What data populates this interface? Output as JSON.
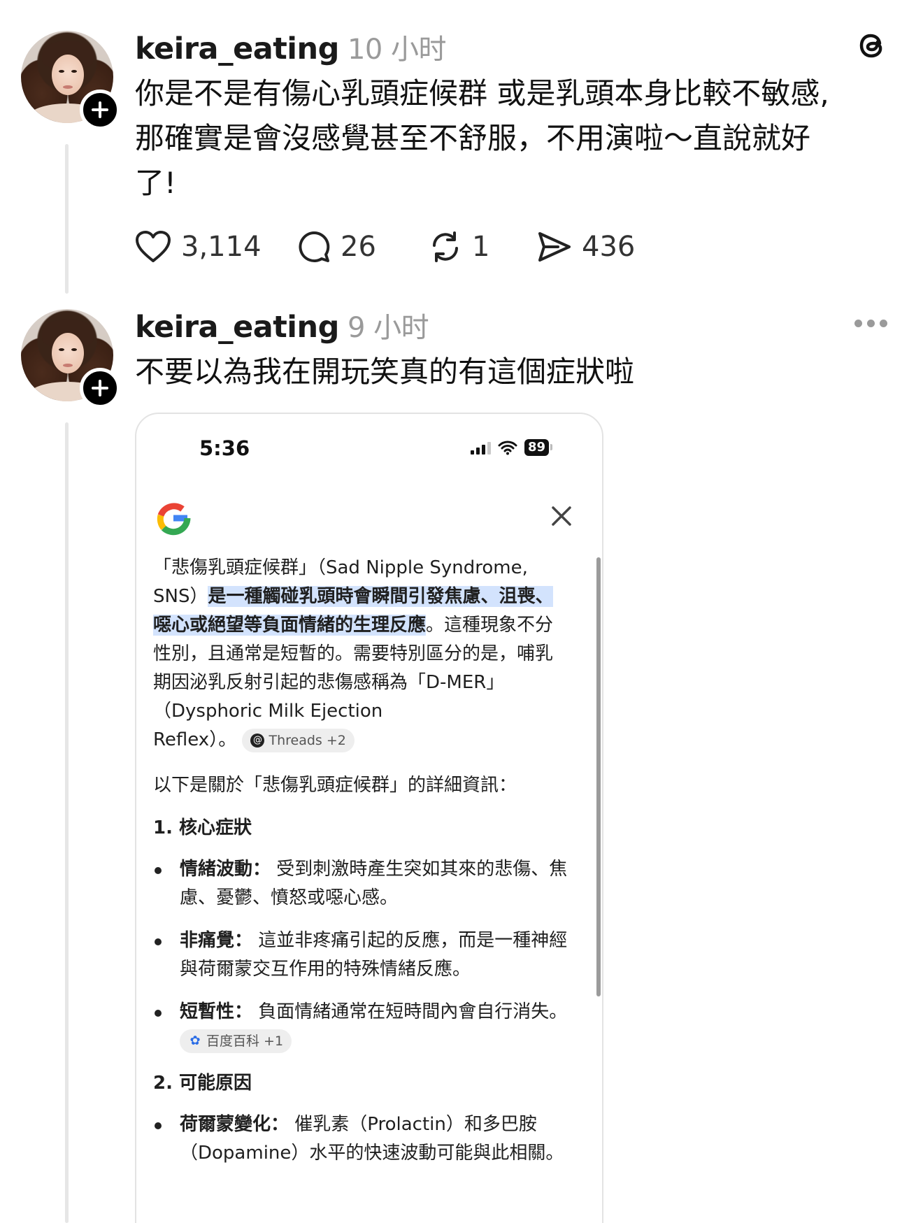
{
  "posts": [
    {
      "username": "keira_eating",
      "time": "10 小时",
      "text_lines": [
        "你是不是有傷心乳頭症候群 或是乳頭本身比較不敏感,",
        "那確實是會沒感覺甚至不舒服，不用演啦～直說就好",
        "了!"
      ],
      "likes": "3,114",
      "replies": "26",
      "reposts": "1",
      "shares": "436"
    },
    {
      "username": "keira_eating",
      "time": "9 小时",
      "text": "不要以為我在開玩笑真的有這個症狀啦"
    }
  ],
  "embedded": {
    "status_time": "5:36",
    "battery": "89",
    "intro_lines": {
      "l1": "「悲傷乳頭症候群」（Sad Nipple Syndrome,",
      "l2_plain": "SNS）",
      "l2_hl": "是一種觸碰乳頭時會瞬間引發焦慮、沮喪、",
      "l3_hl": "噁心或絕望等負面情緒的生理反應",
      "l3_plain": "。這種現象不分",
      "l4": "性別，且通常是短暫的。需要特別區分的是，哺乳",
      "l5": "期因泌乳反射引起的悲傷感稱為「D-MER」",
      "l6": "（Dysphoric Milk Ejection",
      "l7": "Reflex）。"
    },
    "chip1": "Threads +2",
    "detail_intro": "以下是關於「悲傷乳頭症候群」的詳細資訊：",
    "section1_title": "1. 核心症狀",
    "bullets1": [
      {
        "label": "情緒波動：",
        "text": " 受到刺激時產生突如其來的悲傷、焦慮、憂鬱、憤怒或噁心感。"
      },
      {
        "label": "非痛覺：",
        "text": " 這並非疼痛引起的反應，而是一種神經與荷爾蒙交互作用的特殊情緒反應。"
      },
      {
        "label": "短暫性：",
        "text": " 負面情緒通常在短時間內會自行消失。"
      }
    ],
    "chip2": "百度百科 +1",
    "section2_title": "2. 可能原因",
    "bullets2": [
      {
        "label": "荷爾蒙變化：",
        "text": " 催乳素（Prolactin）和多巴胺（Dopamine）水平的快速波動可能與此相關。"
      }
    ]
  }
}
